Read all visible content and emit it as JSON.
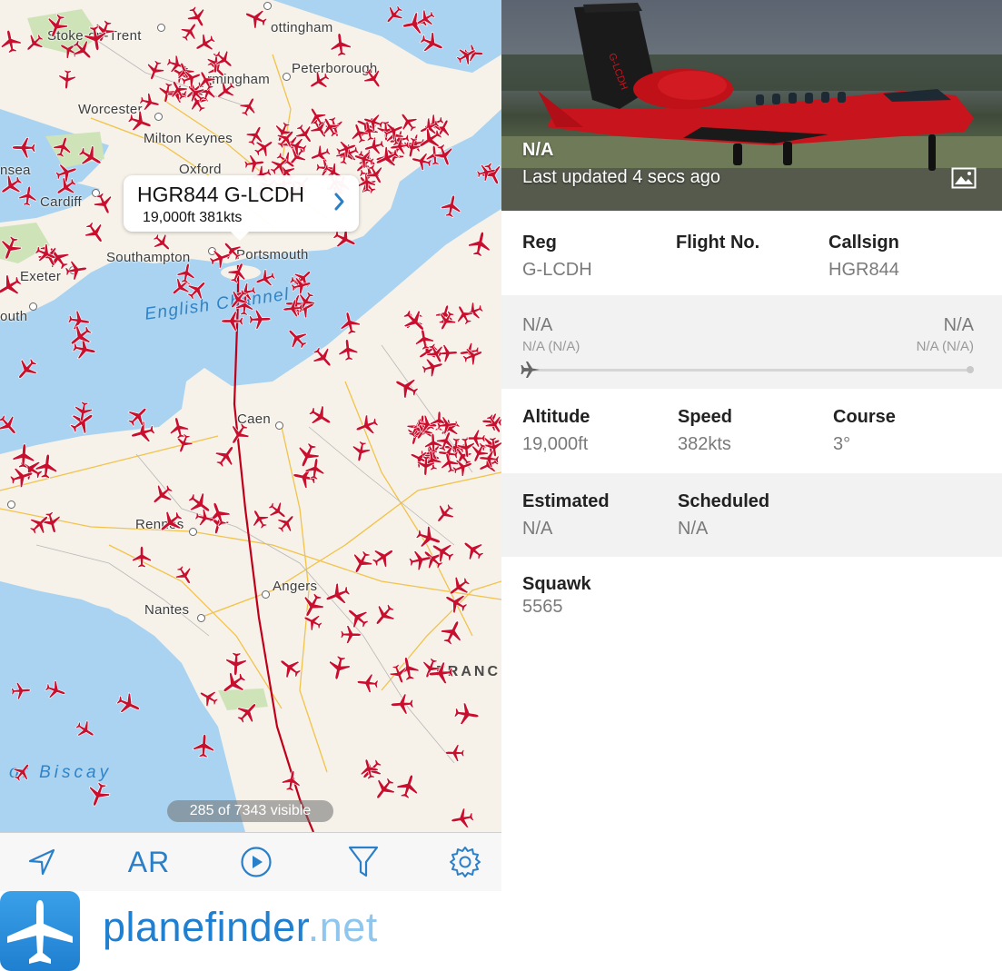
{
  "map": {
    "cities": [
      {
        "name": "Stoke-on-Trent"
      },
      {
        "name": "ottingham"
      },
      {
        "name": "Peterborough"
      },
      {
        "name": "rmingham"
      },
      {
        "name": "Worcester"
      },
      {
        "name": "Milton Keynes"
      },
      {
        "name": "nsea"
      },
      {
        "name": "Cardiff"
      },
      {
        "name": "Oxford"
      },
      {
        "name": "Southampton"
      },
      {
        "name": "Portsmouth"
      },
      {
        "name": "Exeter"
      },
      {
        "name": "outh"
      },
      {
        "name": "Caen"
      },
      {
        "name": "Rennes"
      },
      {
        "name": "Nantes"
      },
      {
        "name": "Angers"
      }
    ],
    "sea_english_channel": "English Channel",
    "sea_biscay": "of Biscay",
    "country_label": "FRANC",
    "callout": {
      "title": "HGR844 G-LCDH",
      "subtitle": "19,000ft 381kts",
      "chevron_icon": "chevron-right-icon"
    },
    "visible_count": "285 of 7343 visible",
    "plane_color": "#c8102e",
    "track_color": "#c0001a"
  },
  "toolbar": {
    "location_icon": "location-arrow-icon",
    "ar_label": "AR",
    "playback_icon": "play-circle-icon",
    "filter_icon": "filter-icon",
    "settings_icon": "gear-icon",
    "accent": "#2a7fc9"
  },
  "brand": {
    "logo_icon": "planefinder-logo-icon",
    "part1": "plane",
    "part2": "finder",
    "part3": ".net"
  },
  "detail": {
    "photo": {
      "status": "N/A",
      "updated": "Last updated 4 secs ago",
      "gallery_icon": "image-icon",
      "aircraft_reg_on_tail": "G-LCDH"
    },
    "reg_label": "Reg",
    "reg_value": "G-LCDH",
    "flight_label": "Flight No.",
    "flight_value": "",
    "callsign_label": "Callsign",
    "callsign_value": "HGR844",
    "route": {
      "from_code": "N/A",
      "from_name": "N/A (N/A)",
      "to_code": "N/A",
      "to_name": "N/A (N/A)",
      "progress": 0
    },
    "altitude_label": "Altitude",
    "altitude_value": "19,000ft",
    "speed_label": "Speed",
    "speed_value": "382kts",
    "course_label": "Course",
    "course_value": "3°",
    "estimated_label": "Estimated",
    "estimated_value": "N/A",
    "scheduled_label": "Scheduled",
    "scheduled_value": "N/A",
    "squawk_label": "Squawk",
    "squawk_value": "5565"
  }
}
